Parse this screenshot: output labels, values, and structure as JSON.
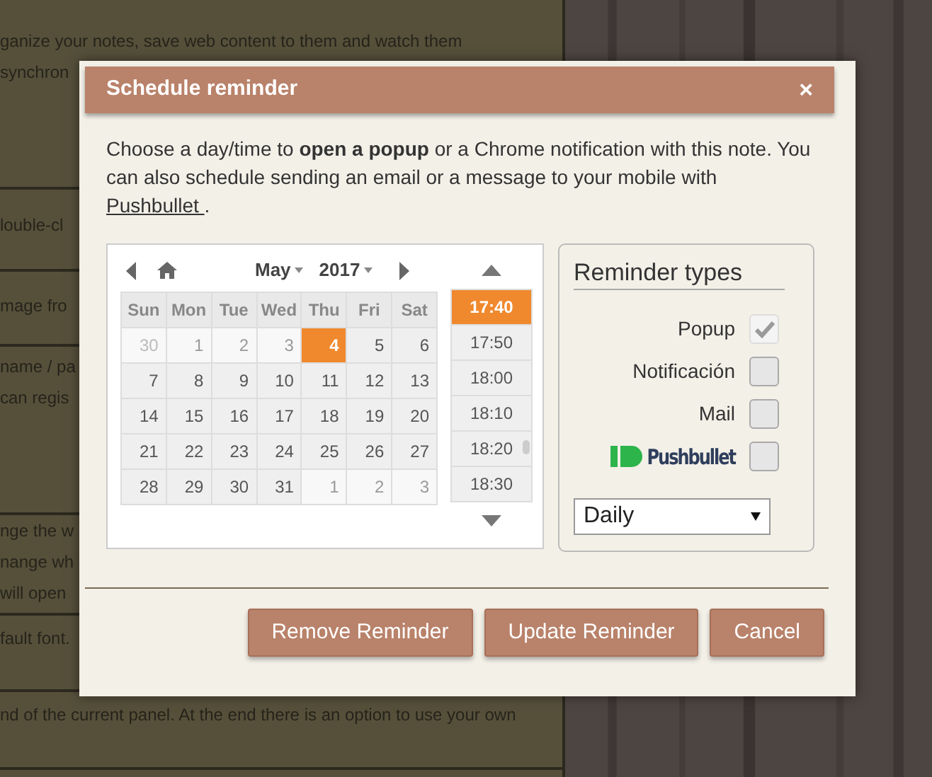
{
  "background": {
    "sections": [
      {
        "lines": [
          "ganize your notes, save web content to them and watch them",
          "synchron"
        ]
      },
      {
        "lines": [
          "louble-cl"
        ]
      },
      {
        "lines": [
          "mage fro"
        ]
      },
      {
        "lines": [
          "name / pa",
          "can regis"
        ]
      },
      {
        "lines": [
          "nge the w",
          "nange wh",
          "will open"
        ]
      },
      {
        "lines": [
          "fault font."
        ]
      },
      {
        "lines": [
          "nd of the current panel. At the end there is an option to use your own"
        ]
      }
    ]
  },
  "dialog": {
    "title": "Schedule reminder",
    "close": "×",
    "description": {
      "text": "Choose a day/time to **open a popup** or a Chrome notification with this note. You can also schedule sending an email or a message to your mobile with ",
      "link": "Pushbullet ",
      "end": "."
    },
    "calendar": {
      "month": "May",
      "year": "2017",
      "weekdays": [
        "Sun",
        "Mon",
        "Tue",
        "Wed",
        "Thu",
        "Fri",
        "Sat"
      ],
      "weeks": [
        [
          {
            "day": "30",
            "other_month": true,
            "past": true,
            "selected": false
          },
          {
            "day": "1",
            "other_month": false,
            "past": true,
            "selected": false
          },
          {
            "day": "2",
            "other_month": false,
            "past": true,
            "selected": false
          },
          {
            "day": "3",
            "other_month": false,
            "past": true,
            "selected": false
          },
          {
            "day": "4",
            "other_month": false,
            "past": false,
            "selected": true
          },
          {
            "day": "5",
            "other_month": false,
            "past": false,
            "selected": false
          },
          {
            "day": "6",
            "other_month": false,
            "past": false,
            "selected": false
          }
        ],
        [
          {
            "day": "7",
            "other_month": false,
            "past": false,
            "selected": false
          },
          {
            "day": "8",
            "other_month": false,
            "past": false,
            "selected": false
          },
          {
            "day": "9",
            "other_month": false,
            "past": false,
            "selected": false
          },
          {
            "day": "10",
            "other_month": false,
            "past": false,
            "selected": false
          },
          {
            "day": "11",
            "other_month": false,
            "past": false,
            "selected": false
          },
          {
            "day": "12",
            "other_month": false,
            "past": false,
            "selected": false
          },
          {
            "day": "13",
            "other_month": false,
            "past": false,
            "selected": false
          }
        ],
        [
          {
            "day": "14",
            "other_month": false,
            "past": false,
            "selected": false
          },
          {
            "day": "15",
            "other_month": false,
            "past": false,
            "selected": false
          },
          {
            "day": "16",
            "other_month": false,
            "past": false,
            "selected": false
          },
          {
            "day": "17",
            "other_month": false,
            "past": false,
            "selected": false
          },
          {
            "day": "18",
            "other_month": false,
            "past": false,
            "selected": false
          },
          {
            "day": "19",
            "other_month": false,
            "past": false,
            "selected": false
          },
          {
            "day": "20",
            "other_month": false,
            "past": false,
            "selected": false
          }
        ],
        [
          {
            "day": "21",
            "other_month": false,
            "past": false,
            "selected": false
          },
          {
            "day": "22",
            "other_month": false,
            "past": false,
            "selected": false
          },
          {
            "day": "23",
            "other_month": false,
            "past": false,
            "selected": false
          },
          {
            "day": "24",
            "other_month": false,
            "past": false,
            "selected": false
          },
          {
            "day": "25",
            "other_month": false,
            "past": false,
            "selected": false
          },
          {
            "day": "26",
            "other_month": false,
            "past": false,
            "selected": false
          },
          {
            "day": "27",
            "other_month": false,
            "past": false,
            "selected": false
          }
        ],
        [
          {
            "day": "28",
            "other_month": false,
            "past": false,
            "selected": false
          },
          {
            "day": "29",
            "other_month": false,
            "past": false,
            "selected": false
          },
          {
            "day": "30",
            "other_month": false,
            "past": false,
            "selected": false
          },
          {
            "day": "31",
            "other_month": false,
            "past": false,
            "selected": false
          },
          {
            "day": "1",
            "other_month": true,
            "past": false,
            "selected": false
          },
          {
            "day": "2",
            "other_month": true,
            "past": false,
            "selected": false
          },
          {
            "day": "3",
            "other_month": true,
            "past": false,
            "selected": false
          }
        ]
      ]
    },
    "times": [
      {
        "label": "17:40",
        "selected": true
      },
      {
        "label": "17:50",
        "selected": false
      },
      {
        "label": "18:00",
        "selected": false
      },
      {
        "label": "18:10",
        "selected": false
      },
      {
        "label": "18:20",
        "selected": false
      },
      {
        "label": "18:30",
        "selected": false
      }
    ],
    "reminder_types": {
      "title": "Reminder types",
      "options": [
        {
          "kind": "text",
          "label": "Popup",
          "checked": true,
          "disabled": true
        },
        {
          "kind": "text",
          "label": "Notificación",
          "checked": false,
          "disabled": false
        },
        {
          "kind": "text",
          "label": "Mail",
          "checked": false,
          "disabled": false
        },
        {
          "kind": "logo",
          "label": "Pushbullet",
          "checked": false,
          "disabled": false
        }
      ],
      "repeat": "Daily"
    },
    "buttons": [
      "Remove Reminder",
      "Update Reminder",
      "Cancel"
    ]
  }
}
